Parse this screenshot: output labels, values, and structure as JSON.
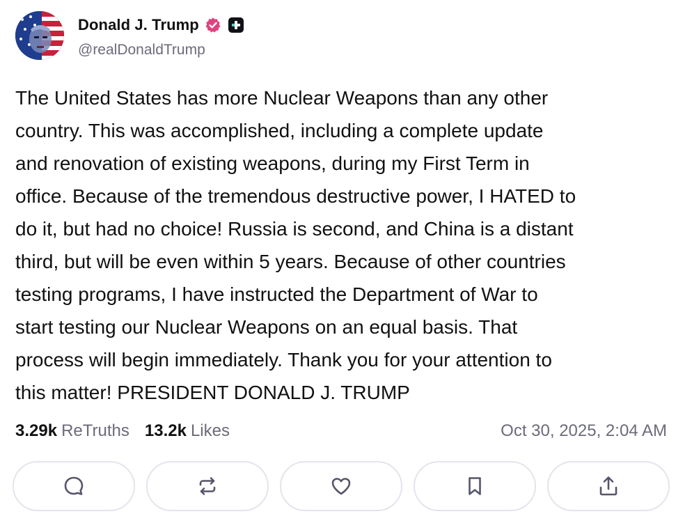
{
  "author": {
    "display_name": "Donald J. Trump",
    "handle": "@realDonaldTrump",
    "verified_icon": "verified-badge-icon",
    "plus_icon": "plus-badge-icon",
    "verified_color": "#e1427f"
  },
  "post": {
    "text": "The United States has more Nuclear Weapons than any other\ncountry. This was accomplished, including a complete update\nand renovation of existing weapons, during my First Term in\noffice. Because of the tremendous destructive power, I HATED to\ndo it, but had no choice! Russia is second, and China is a distant\nthird, but will be even within 5 years. Because of other countries\ntesting programs, I have instructed the Department of War to\nstart testing our Nuclear Weapons on an equal basis. That\nprocess will begin immediately. Thank you for your attention to\nthis matter! PRESIDENT DONALD J. TRUMP"
  },
  "stats": {
    "retruths_count": "3.29k",
    "retruths_label": "ReTruths",
    "likes_count": "13.2k",
    "likes_label": "Likes",
    "timestamp": "Oct 30, 2025, 2:04 AM"
  },
  "actions": [
    {
      "name": "reply",
      "icon": "comment-icon"
    },
    {
      "name": "retruth",
      "icon": "repost-icon"
    },
    {
      "name": "like",
      "icon": "heart-icon"
    },
    {
      "name": "bookmark",
      "icon": "bookmark-icon"
    },
    {
      "name": "share",
      "icon": "share-icon"
    }
  ],
  "colors": {
    "text": "#111111",
    "muted": "#6b6b7b",
    "button_border": "#e6e3ec",
    "icon": "#55556a"
  }
}
